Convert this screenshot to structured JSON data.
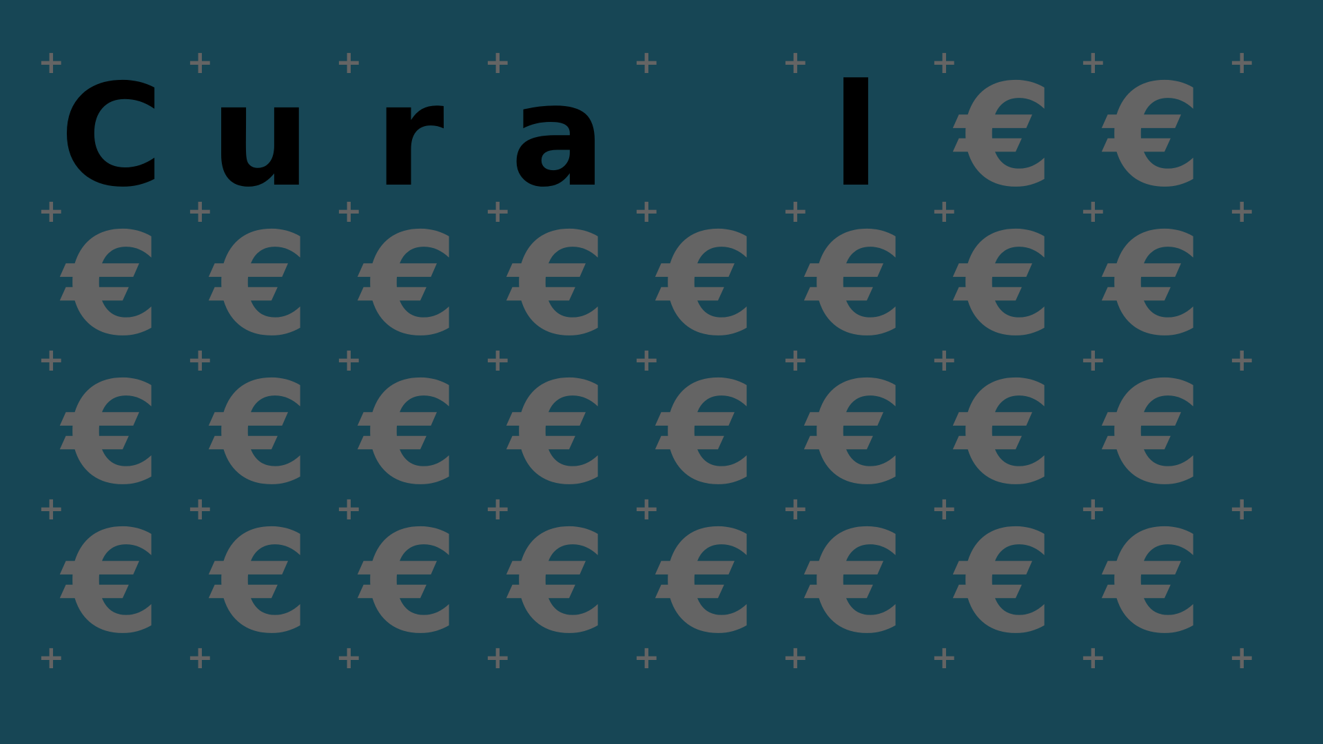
{
  "colors": {
    "background": "#174655",
    "letter": "#000000",
    "symbol": "#646464"
  },
  "cross_glyph": "+",
  "grid": {
    "rows": [
      [
        "C",
        "u",
        "r",
        "a",
        "",
        "l",
        "€",
        "€"
      ],
      [
        "€",
        "€",
        "€",
        "€",
        "€",
        "€",
        "€",
        "€"
      ],
      [
        "€",
        "€",
        "€",
        "€",
        "€",
        "€",
        "€",
        "€"
      ],
      [
        "€",
        "€",
        "€",
        "€",
        "€",
        "€",
        "€",
        "€"
      ]
    ]
  }
}
